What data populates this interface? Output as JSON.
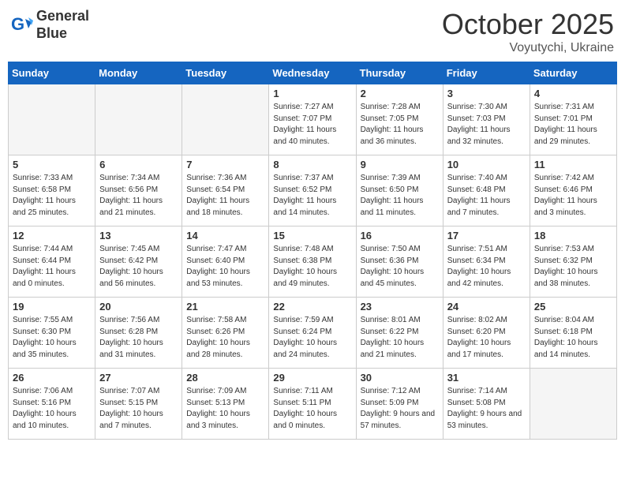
{
  "header": {
    "logo_line1": "General",
    "logo_line2": "Blue",
    "month": "October 2025",
    "location": "Voyutychi, Ukraine"
  },
  "weekdays": [
    "Sunday",
    "Monday",
    "Tuesday",
    "Wednesday",
    "Thursday",
    "Friday",
    "Saturday"
  ],
  "weeks": [
    [
      {
        "day": "",
        "info": ""
      },
      {
        "day": "",
        "info": ""
      },
      {
        "day": "",
        "info": ""
      },
      {
        "day": "1",
        "info": "Sunrise: 7:27 AM\nSunset: 7:07 PM\nDaylight: 11 hours\nand 40 minutes."
      },
      {
        "day": "2",
        "info": "Sunrise: 7:28 AM\nSunset: 7:05 PM\nDaylight: 11 hours\nand 36 minutes."
      },
      {
        "day": "3",
        "info": "Sunrise: 7:30 AM\nSunset: 7:03 PM\nDaylight: 11 hours\nand 32 minutes."
      },
      {
        "day": "4",
        "info": "Sunrise: 7:31 AM\nSunset: 7:01 PM\nDaylight: 11 hours\nand 29 minutes."
      }
    ],
    [
      {
        "day": "5",
        "info": "Sunrise: 7:33 AM\nSunset: 6:58 PM\nDaylight: 11 hours\nand 25 minutes."
      },
      {
        "day": "6",
        "info": "Sunrise: 7:34 AM\nSunset: 6:56 PM\nDaylight: 11 hours\nand 21 minutes."
      },
      {
        "day": "7",
        "info": "Sunrise: 7:36 AM\nSunset: 6:54 PM\nDaylight: 11 hours\nand 18 minutes."
      },
      {
        "day": "8",
        "info": "Sunrise: 7:37 AM\nSunset: 6:52 PM\nDaylight: 11 hours\nand 14 minutes."
      },
      {
        "day": "9",
        "info": "Sunrise: 7:39 AM\nSunset: 6:50 PM\nDaylight: 11 hours\nand 11 minutes."
      },
      {
        "day": "10",
        "info": "Sunrise: 7:40 AM\nSunset: 6:48 PM\nDaylight: 11 hours\nand 7 minutes."
      },
      {
        "day": "11",
        "info": "Sunrise: 7:42 AM\nSunset: 6:46 PM\nDaylight: 11 hours\nand 3 minutes."
      }
    ],
    [
      {
        "day": "12",
        "info": "Sunrise: 7:44 AM\nSunset: 6:44 PM\nDaylight: 11 hours\nand 0 minutes."
      },
      {
        "day": "13",
        "info": "Sunrise: 7:45 AM\nSunset: 6:42 PM\nDaylight: 10 hours\nand 56 minutes."
      },
      {
        "day": "14",
        "info": "Sunrise: 7:47 AM\nSunset: 6:40 PM\nDaylight: 10 hours\nand 53 minutes."
      },
      {
        "day": "15",
        "info": "Sunrise: 7:48 AM\nSunset: 6:38 PM\nDaylight: 10 hours\nand 49 minutes."
      },
      {
        "day": "16",
        "info": "Sunrise: 7:50 AM\nSunset: 6:36 PM\nDaylight: 10 hours\nand 45 minutes."
      },
      {
        "day": "17",
        "info": "Sunrise: 7:51 AM\nSunset: 6:34 PM\nDaylight: 10 hours\nand 42 minutes."
      },
      {
        "day": "18",
        "info": "Sunrise: 7:53 AM\nSunset: 6:32 PM\nDaylight: 10 hours\nand 38 minutes."
      }
    ],
    [
      {
        "day": "19",
        "info": "Sunrise: 7:55 AM\nSunset: 6:30 PM\nDaylight: 10 hours\nand 35 minutes."
      },
      {
        "day": "20",
        "info": "Sunrise: 7:56 AM\nSunset: 6:28 PM\nDaylight: 10 hours\nand 31 minutes."
      },
      {
        "day": "21",
        "info": "Sunrise: 7:58 AM\nSunset: 6:26 PM\nDaylight: 10 hours\nand 28 minutes."
      },
      {
        "day": "22",
        "info": "Sunrise: 7:59 AM\nSunset: 6:24 PM\nDaylight: 10 hours\nand 24 minutes."
      },
      {
        "day": "23",
        "info": "Sunrise: 8:01 AM\nSunset: 6:22 PM\nDaylight: 10 hours\nand 21 minutes."
      },
      {
        "day": "24",
        "info": "Sunrise: 8:02 AM\nSunset: 6:20 PM\nDaylight: 10 hours\nand 17 minutes."
      },
      {
        "day": "25",
        "info": "Sunrise: 8:04 AM\nSunset: 6:18 PM\nDaylight: 10 hours\nand 14 minutes."
      }
    ],
    [
      {
        "day": "26",
        "info": "Sunrise: 7:06 AM\nSunset: 5:16 PM\nDaylight: 10 hours\nand 10 minutes."
      },
      {
        "day": "27",
        "info": "Sunrise: 7:07 AM\nSunset: 5:15 PM\nDaylight: 10 hours\nand 7 minutes."
      },
      {
        "day": "28",
        "info": "Sunrise: 7:09 AM\nSunset: 5:13 PM\nDaylight: 10 hours\nand 3 minutes."
      },
      {
        "day": "29",
        "info": "Sunrise: 7:11 AM\nSunset: 5:11 PM\nDaylight: 10 hours\nand 0 minutes."
      },
      {
        "day": "30",
        "info": "Sunrise: 7:12 AM\nSunset: 5:09 PM\nDaylight: 9 hours\nand 57 minutes."
      },
      {
        "day": "31",
        "info": "Sunrise: 7:14 AM\nSunset: 5:08 PM\nDaylight: 9 hours\nand 53 minutes."
      },
      {
        "day": "",
        "info": ""
      }
    ]
  ]
}
